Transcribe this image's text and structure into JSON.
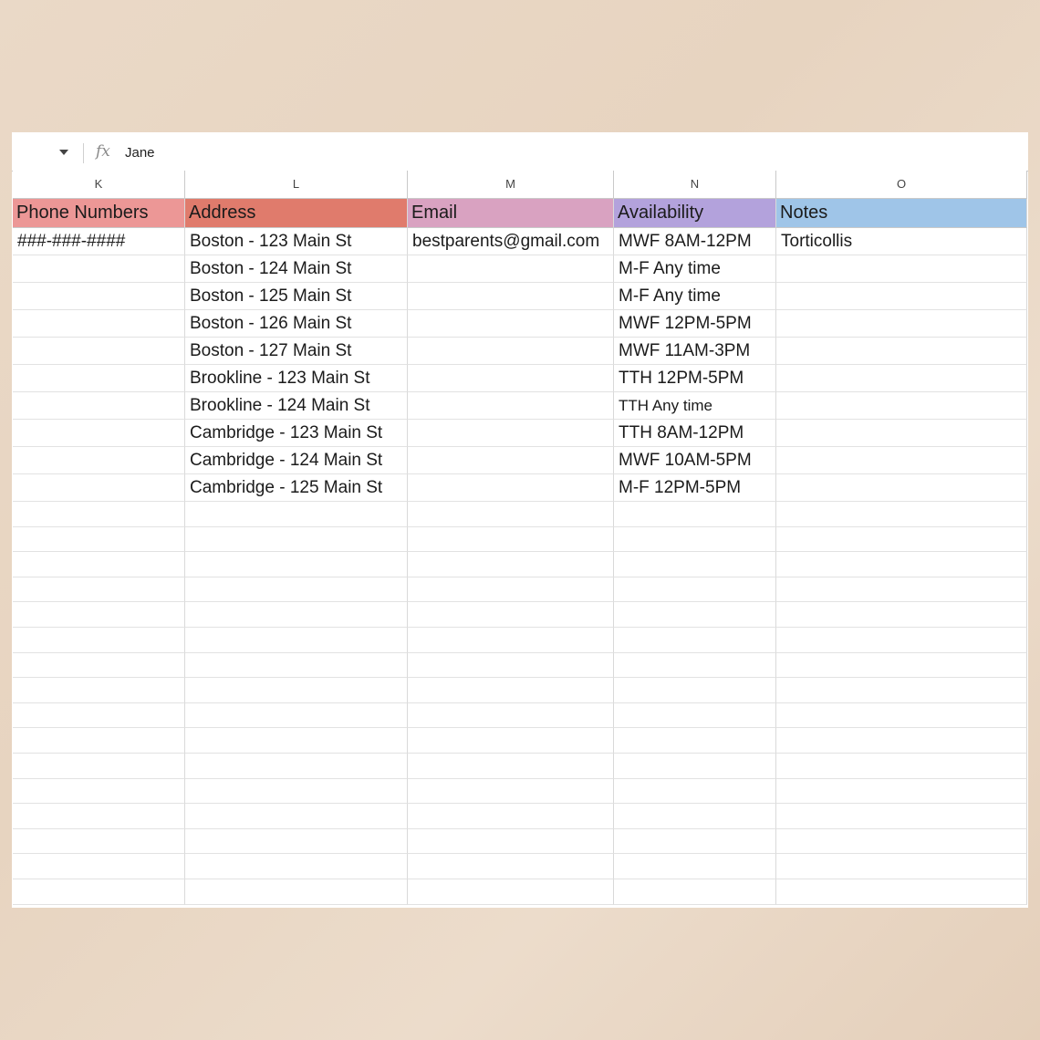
{
  "formula_bar": {
    "fx_label": "fx",
    "value": "Jane"
  },
  "columns": [
    "K",
    "L",
    "M",
    "N",
    "O"
  ],
  "headers": [
    "Phone Numbers",
    "Address",
    "Email",
    "Availability",
    "Notes"
  ],
  "header_colors": [
    "#ec9796",
    "#e07b6c",
    "#d9a2c1",
    "#b3a2dc",
    "#9fc5e8"
  ],
  "rows": [
    [
      "###-###-####",
      "Boston - 123 Main St",
      "bestparents@gmail.com",
      "MWF 8AM-12PM",
      "Torticollis"
    ],
    [
      "",
      "Boston - 124 Main St",
      "",
      "M-F Any time",
      ""
    ],
    [
      "",
      "Boston - 125 Main St",
      "",
      "M-F Any time",
      ""
    ],
    [
      "",
      "Boston - 126 Main St",
      "",
      "MWF 12PM-5PM",
      ""
    ],
    [
      "",
      "Boston - 127 Main St",
      "",
      "MWF 11AM-3PM",
      ""
    ],
    [
      "",
      "Brookline - 123 Main St",
      "",
      "TTH 12PM-5PM",
      ""
    ],
    [
      "",
      "Brookline - 124 Main St",
      "",
      "TTH Any time",
      ""
    ],
    [
      "",
      "Cambridge - 123 Main St",
      "",
      "TTH 8AM-12PM",
      ""
    ],
    [
      "",
      "Cambridge - 124 Main St",
      "",
      "MWF  10AM-5PM",
      ""
    ],
    [
      "",
      "Cambridge - 125 Main St",
      "",
      "M-F 12PM-5PM",
      ""
    ]
  ]
}
